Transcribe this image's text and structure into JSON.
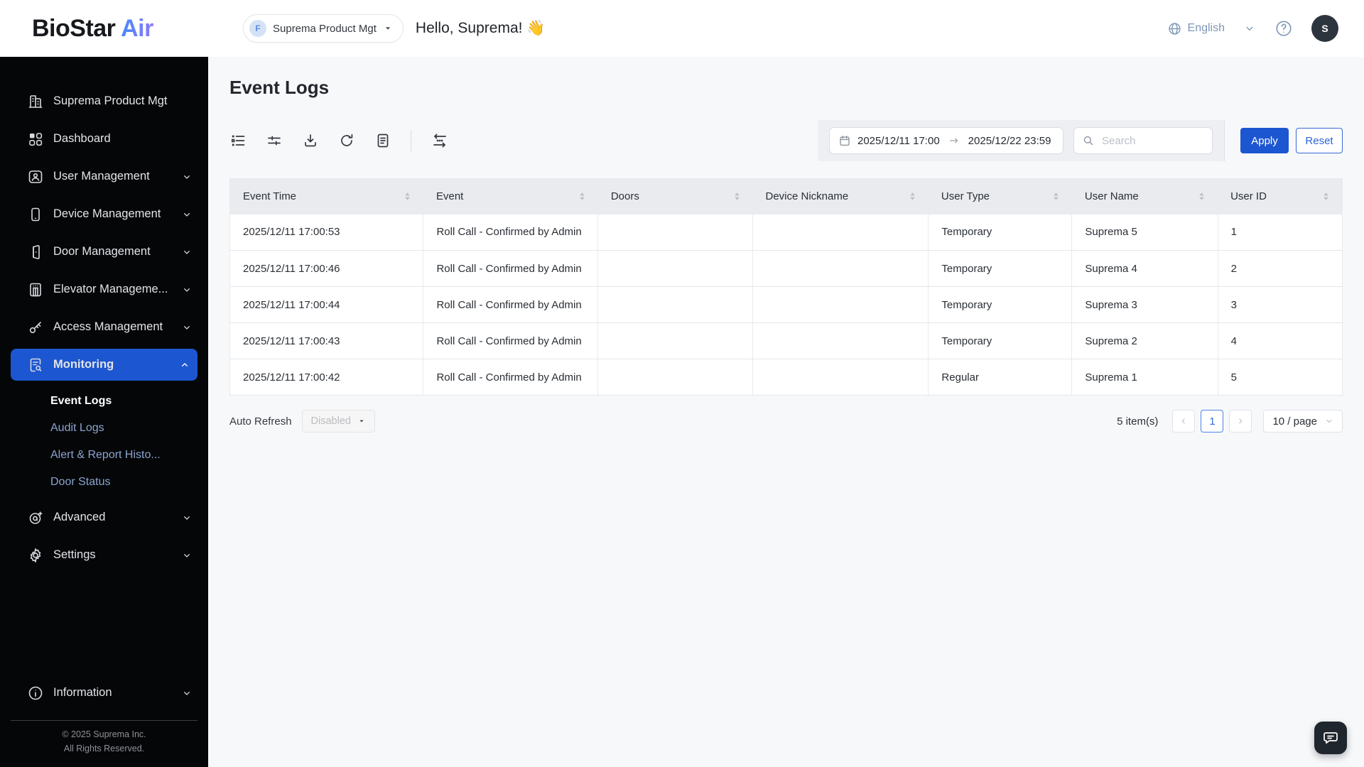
{
  "header": {
    "logo_primary": "BioStar",
    "logo_accent": " Air",
    "org_selector": {
      "badge": "F",
      "label": "Suprema Product Mgt"
    },
    "greeting": "Hello, Suprema! 👋",
    "language_label": "English",
    "avatar_initial": "S"
  },
  "sidebar": {
    "items": [
      {
        "label": "Suprema Product Mgt"
      },
      {
        "label": "Dashboard"
      },
      {
        "label": "User Management"
      },
      {
        "label": "Device Management"
      },
      {
        "label": "Door Management"
      },
      {
        "label": "Elevator Manageme..."
      },
      {
        "label": "Access Management"
      },
      {
        "label": "Monitoring"
      },
      {
        "label": "Advanced"
      },
      {
        "label": "Settings"
      },
      {
        "label": "Information"
      }
    ],
    "monitoring_submenu": [
      {
        "label": "Event Logs",
        "active": true
      },
      {
        "label": "Audit Logs",
        "active": false
      },
      {
        "label": "Alert & Report Histo...",
        "active": false
      },
      {
        "label": "Door Status",
        "active": false
      }
    ],
    "copyright_line1": "© 2025 Suprema Inc.",
    "copyright_line2": "All Rights Reserved."
  },
  "main": {
    "page_title": "Event Logs",
    "filter_bar": {
      "date_from": "2025/12/11 17:00",
      "date_to": "2025/12/22 23:59",
      "search_placeholder": "Search",
      "apply_label": "Apply",
      "reset_label": "Reset"
    },
    "table": {
      "columns": [
        "Event Time",
        "Event",
        "Doors",
        "Device Nickname",
        "User Type",
        "User Name",
        "User ID"
      ],
      "rows": [
        [
          "2025/12/11 17:00:53",
          "Roll Call - Confirmed by Admin",
          "",
          "",
          "Temporary",
          "Suprema 5",
          "1"
        ],
        [
          "2025/12/11 17:00:46",
          "Roll Call - Confirmed by Admin",
          "",
          "",
          "Temporary",
          "Suprema 4",
          "2"
        ],
        [
          "2025/12/11 17:00:44",
          "Roll Call - Confirmed by Admin",
          "",
          "",
          "Temporary",
          "Suprema 3",
          "3"
        ],
        [
          "2025/12/11 17:00:43",
          "Roll Call - Confirmed by Admin",
          "",
          "",
          "Temporary",
          "Suprema 2",
          "4"
        ],
        [
          "2025/12/11 17:00:42",
          "Roll Call - Confirmed by Admin",
          "",
          "",
          "Regular",
          "Suprema 1",
          "5"
        ]
      ]
    },
    "table_footer": {
      "auto_refresh_label": "Auto Refresh",
      "auto_refresh_value": "Disabled",
      "items_count": "5 item(s)",
      "page_number": "1",
      "page_size": "10 / page"
    }
  },
  "colors": {
    "primary_blue": "#1d56d1",
    "sidebar_bg": "#050608",
    "logo_gradient_start": "#3d8bfd",
    "logo_gradient_end": "#8d7bf7"
  }
}
